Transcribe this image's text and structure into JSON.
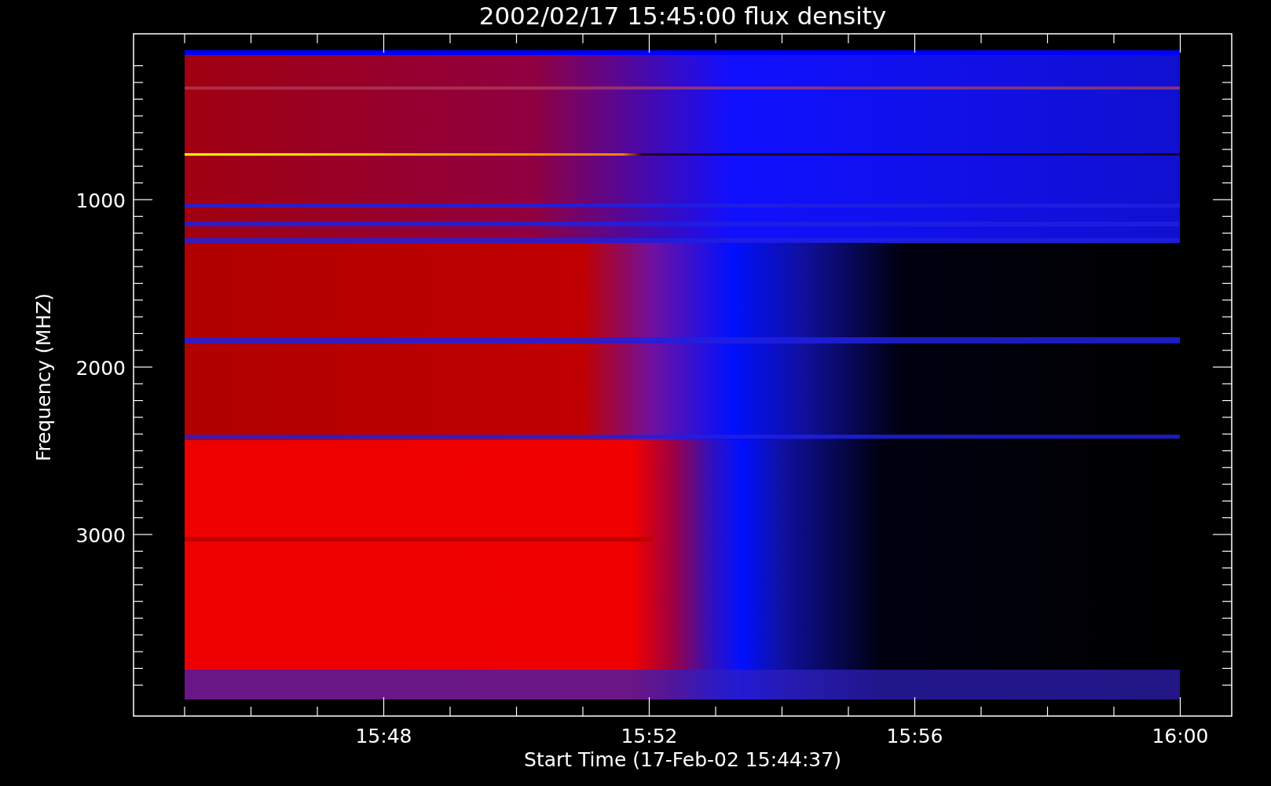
{
  "title": "2002/02/17 15:45:00 flux density",
  "plot": {
    "ylabel": "Frequency (MHZ)",
    "xlabel": "Start Time (17-Feb-02 15:44:37)",
    "yticks": [
      {
        "label": "1000"
      },
      {
        "label": "2000"
      },
      {
        "label": "3000"
      }
    ],
    "xticks": [
      {
        "label": "15:48"
      },
      {
        "label": "15:52"
      },
      {
        "label": "15:56"
      },
      {
        "label": "16:00"
      }
    ]
  }
}
